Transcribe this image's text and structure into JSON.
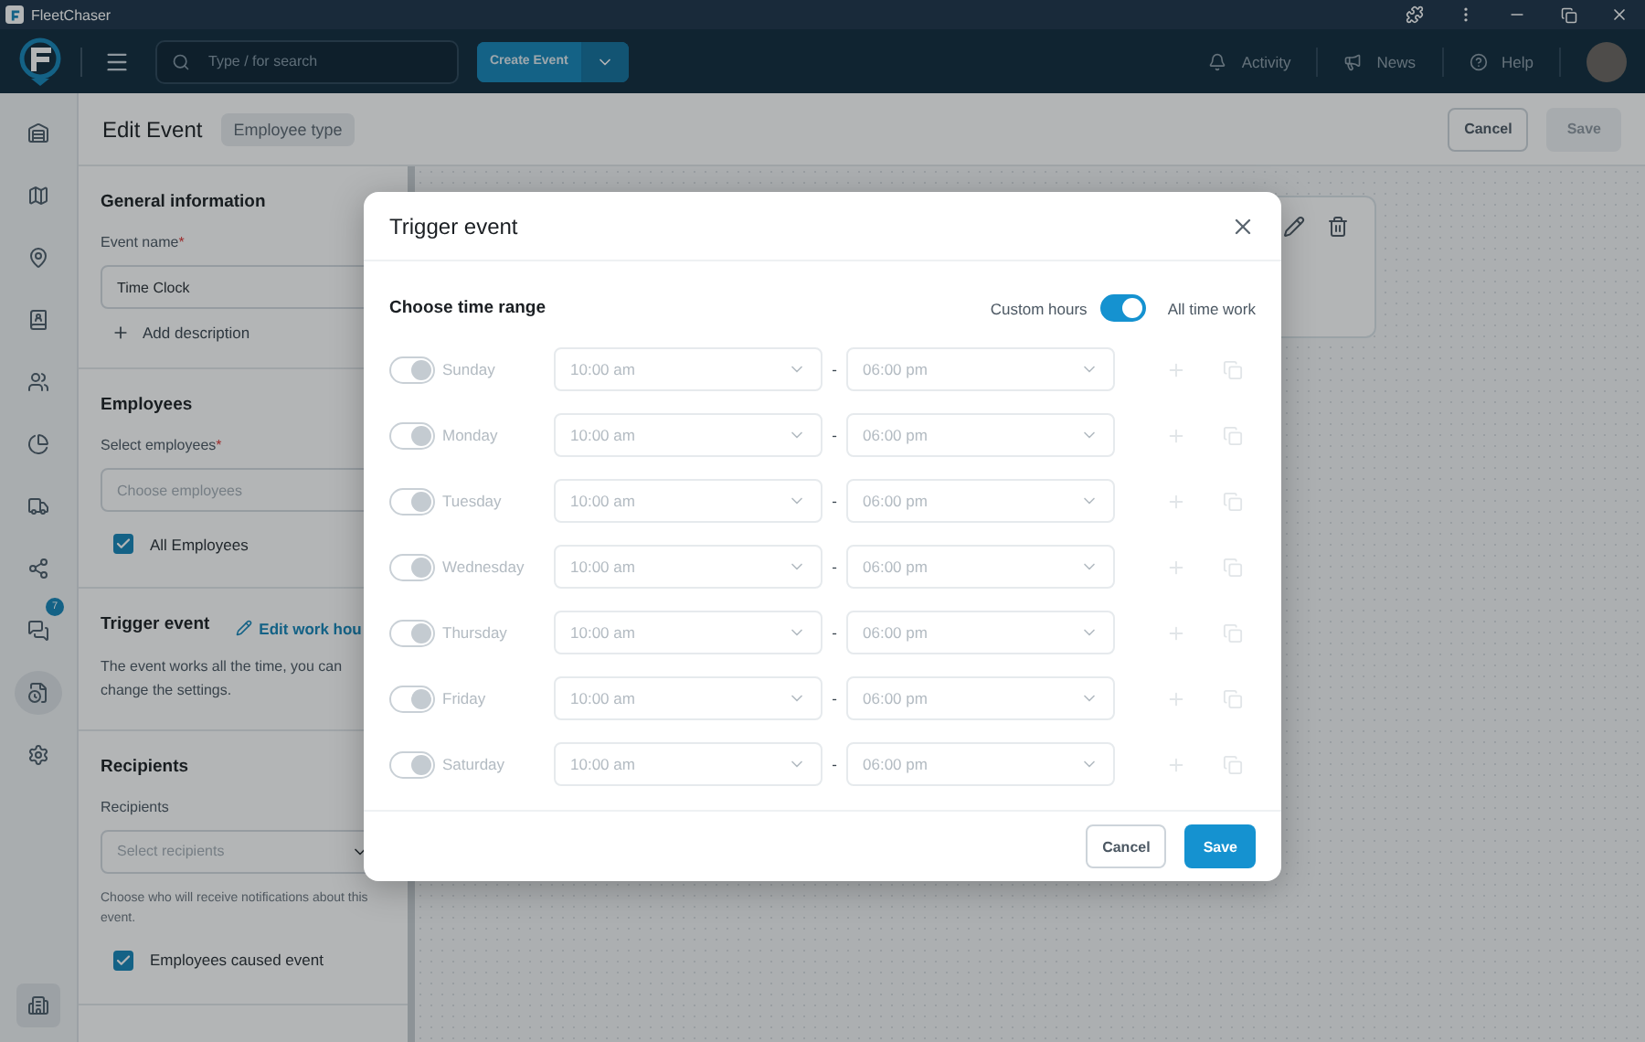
{
  "title_bar": {
    "app_name": "FleetChaser"
  },
  "header": {
    "search": {
      "placeholder": "Type / for search"
    },
    "create_button": "Create Event",
    "nav": [
      {
        "label": "Activity"
      },
      {
        "label": "News"
      },
      {
        "label": "Help"
      }
    ]
  },
  "sidebar": {
    "items": [
      {
        "selected": false
      },
      {
        "selected": false
      },
      {
        "selected": false
      },
      {
        "selected": false
      },
      {
        "selected": false
      },
      {
        "selected": false
      },
      {
        "selected": false
      },
      {
        "selected": false
      },
      {
        "selected": false,
        "badge": "7"
      },
      {
        "selected": true
      },
      {
        "selected": false
      }
    ],
    "bottom_item": {
      "selected": true
    }
  },
  "page": {
    "title": "Edit Event",
    "type_chip": "Employee type",
    "cancel": "Cancel",
    "save": {
      "label": "Save",
      "disabled": true
    }
  },
  "form": {
    "general": {
      "heading": "General information",
      "event_name_label": "Event name",
      "required_mark": "*",
      "event_name_value": "Time Clock",
      "add_description": "Add description"
    },
    "employees": {
      "heading": "Employees",
      "select_label": "Select employees",
      "required_mark": "*",
      "placeholder": "Choose employees",
      "all_employees": {
        "label": "All Employees",
        "checked": true
      }
    },
    "trigger": {
      "heading": "Trigger event",
      "edit_link": "Edit work hou",
      "description": "The event works all the time, you can change the settings."
    },
    "recipients": {
      "heading": "Recipients",
      "label": "Recipients",
      "placeholder": "Select recipients",
      "hint": "Choose who will receive notifications about this event.",
      "caused": {
        "label": "Employees caused event",
        "checked": true
      }
    }
  },
  "modal": {
    "title": "Trigger event",
    "section": "Choose time range",
    "custom_hours_label": "Custom hours",
    "all_time_label": "All time work",
    "all_time_on": true,
    "days": [
      {
        "name": "Sunday",
        "on": true,
        "disabled": true,
        "start": "10:00 am",
        "separator": "-",
        "end": "06:00 pm"
      },
      {
        "name": "Monday",
        "on": true,
        "disabled": true,
        "start": "10:00 am",
        "separator": "-",
        "end": "06:00 pm"
      },
      {
        "name": "Tuesday",
        "on": true,
        "disabled": true,
        "start": "10:00 am",
        "separator": "-",
        "end": "06:00 pm"
      },
      {
        "name": "Wednesday",
        "on": true,
        "disabled": true,
        "start": "10:00 am",
        "separator": "-",
        "end": "06:00 pm"
      },
      {
        "name": "Thursday",
        "on": true,
        "disabled": true,
        "start": "10:00 am",
        "separator": "-",
        "end": "06:00 pm"
      },
      {
        "name": "Friday",
        "on": true,
        "disabled": true,
        "start": "10:00 am",
        "separator": "-",
        "end": "06:00 pm"
      },
      {
        "name": "Saturday",
        "on": true,
        "disabled": true,
        "start": "10:00 am",
        "separator": "-",
        "end": "06:00 pm"
      }
    ],
    "cancel": "Cancel",
    "save": "Save"
  }
}
